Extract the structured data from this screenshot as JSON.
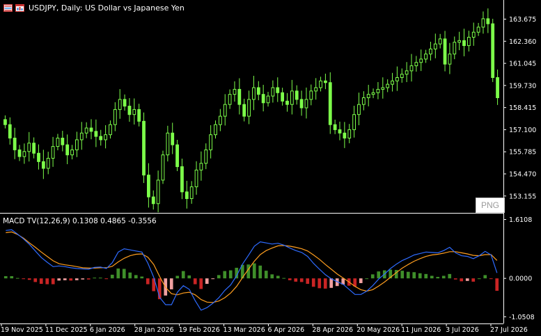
{
  "header": {
    "title": "USDJPY, Daily:  US Dollar vs Japanese Yen",
    "icons": [
      "symbol-list-icon",
      "chart-window-icon"
    ]
  },
  "indicator": {
    "label": "MACD TV(12,26,9) 0.1308 0.4865 -0.3556"
  },
  "png_button": {
    "label": "PNG"
  },
  "colors": {
    "background": "#000000",
    "candle": "#7dff4a",
    "macd_line": "#2e6bff",
    "signal_line": "#ff9e1f",
    "hist_pos": "#3f8f2a",
    "hist_neg": "#c92424",
    "hist_neg_light": "#f0a0a0",
    "separator": "#ffffff"
  },
  "chart_data": [
    {
      "type": "candlestick",
      "symbol": "USDJPY",
      "timeframe": "Daily",
      "price_ticks": [
        "163.675",
        "162.360",
        "161.045",
        "159.730",
        "158.415",
        "157.100",
        "155.785",
        "154.470",
        "153.155"
      ],
      "ylim": [
        152.4,
        164.4
      ],
      "x_ticks": [
        "19 Nov 2025",
        "11 Dec 2025",
        "6 Jan 2026",
        "28 Jan 2026",
        "19 Feb 2026",
        "13 Mar 2026",
        "6 Apr 2026",
        "28 Apr 2026",
        "20 May 2026",
        "11 Jun 2026",
        "3 Jul 2026",
        "27 Jul 2026"
      ],
      "close": [
        157.4,
        156.6,
        155.9,
        155.5,
        155.8,
        156.3,
        155.7,
        155.2,
        154.8,
        155.4,
        156.1,
        156.6,
        156.2,
        155.6,
        155.9,
        156.5,
        156.9,
        157.2,
        157.0,
        156.7,
        156.5,
        156.8,
        157.4,
        158.3,
        158.9,
        158.5,
        158.0,
        158.3,
        157.6,
        154.4,
        153.1,
        152.7,
        154.1,
        155.6,
        156.9,
        156.2,
        154.9,
        153.4,
        153.0,
        153.7,
        154.7,
        155.1,
        155.9,
        156.8,
        157.4,
        157.9,
        158.6,
        159.2,
        159.5,
        158.6,
        157.9,
        158.9,
        159.6,
        159.2,
        158.7,
        159.1,
        159.6,
        159.3,
        158.8,
        158.6,
        159.4,
        158.9,
        158.4,
        158.9,
        159.4,
        159.6,
        160.0,
        159.9,
        157.4,
        157.1,
        156.9,
        156.6,
        157.1,
        158.0,
        158.6,
        159.0,
        159.2,
        159.3,
        159.5,
        159.6,
        159.8,
        160.0,
        160.2,
        160.4,
        160.6,
        160.9,
        161.1,
        161.3,
        161.6,
        161.9,
        162.2,
        162.5,
        161.0,
        161.6,
        162.3,
        162.4,
        162.1,
        162.6,
        162.9,
        163.2,
        163.7,
        163.4,
        160.2,
        159.0
      ],
      "macd": [
        1.31,
        1.33,
        1.21,
        1.08,
        0.93,
        0.75,
        0.57,
        0.44,
        0.32,
        0.34,
        0.32,
        0.29,
        0.27,
        0.26,
        0.25,
        0.3,
        0.31,
        0.27,
        0.43,
        0.72,
        0.81,
        0.78,
        0.75,
        0.72,
        0.42,
        0.03,
        -0.52,
        -0.72,
        -0.72,
        -0.38,
        -0.2,
        -0.3,
        -0.61,
        -0.87,
        -0.8,
        -0.68,
        -0.53,
        -0.33,
        -0.18,
        0.07,
        0.39,
        0.63,
        0.88,
        1.0,
        0.97,
        0.94,
        0.96,
        0.91,
        0.83,
        0.76,
        0.71,
        0.6,
        0.41,
        0.25,
        0.1,
        -0.01,
        -0.09,
        -0.16,
        -0.3,
        -0.44,
        -0.44,
        -0.35,
        -0.2,
        -0.02,
        0.12,
        0.27,
        0.39,
        0.49,
        0.56,
        0.64,
        0.68,
        0.72,
        0.71,
        0.7,
        0.76,
        0.85,
        0.7,
        0.62,
        0.6,
        0.54,
        0.62,
        0.74,
        0.64,
        0.15
      ],
      "signal": [
        1.25,
        1.27,
        1.2,
        1.1,
        0.97,
        0.85,
        0.72,
        0.6,
        0.48,
        0.4,
        0.37,
        0.35,
        0.32,
        0.29,
        0.28,
        0.28,
        0.29,
        0.29,
        0.33,
        0.45,
        0.55,
        0.62,
        0.66,
        0.67,
        0.58,
        0.38,
        0.05,
        -0.25,
        -0.42,
        -0.45,
        -0.4,
        -0.38,
        -0.45,
        -0.58,
        -0.65,
        -0.66,
        -0.62,
        -0.53,
        -0.4,
        -0.22,
        0.02,
        0.25,
        0.47,
        0.65,
        0.76,
        0.83,
        0.89,
        0.9,
        0.88,
        0.85,
        0.81,
        0.75,
        0.64,
        0.52,
        0.38,
        0.25,
        0.12,
        0.01,
        -0.1,
        -0.22,
        -0.31,
        -0.35,
        -0.31,
        -0.21,
        -0.1,
        0.03,
        0.16,
        0.28,
        0.38,
        0.47,
        0.54,
        0.6,
        0.64,
        0.66,
        0.69,
        0.73,
        0.73,
        0.7,
        0.67,
        0.63,
        0.62,
        0.65,
        0.65,
        0.49
      ],
      "macd_ticks": [
        "1.6108",
        "0.0000",
        "-1.0508"
      ],
      "macd_ylim": [
        -1.12,
        1.64
      ]
    }
  ]
}
